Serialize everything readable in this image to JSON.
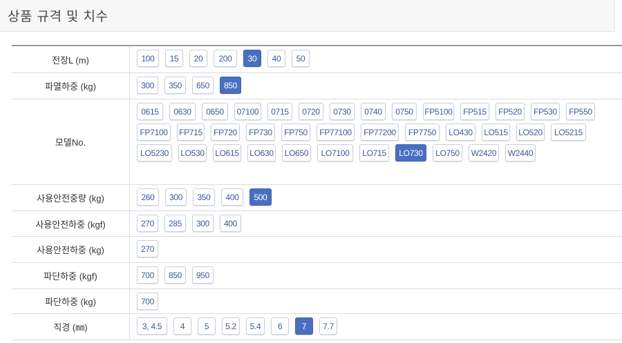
{
  "header": {
    "title": "상품 규격 및 치수"
  },
  "colors": {
    "selected_bg": "#4a6fc1",
    "option_text": "#3c5a9a",
    "border": "#c8cedc"
  },
  "rows": [
    {
      "label": "전장L (m)",
      "options": [
        "100",
        "15",
        "20",
        "200",
        "30",
        "40",
        "50"
      ],
      "selected": "30"
    },
    {
      "label": "파열하중 (kg)",
      "options": [
        "300",
        "350",
        "650",
        "850"
      ],
      "selected": "850"
    },
    {
      "label": "모델No.",
      "options": [
        "0615",
        "0630",
        "0650",
        "07100",
        "0715",
        "0720",
        "0730",
        "0740",
        "0750",
        "FP5100",
        "FP515",
        "FP520",
        "FP530",
        "FP550",
        "FP7100",
        "FP715",
        "FP720",
        "FP730",
        "FP750",
        "FP77100",
        "FP77200",
        "FP7750",
        "LO430",
        "LO515",
        "LO520",
        "LO5215",
        "LO5230",
        "LO530",
        "LO615",
        "LO630",
        "LO650",
        "LO7100",
        "LO715",
        "LO730",
        "LO750",
        "W2420",
        "W2440"
      ],
      "selected": "LO730"
    },
    {
      "label": "사용안전중량 (kg)",
      "options": [
        "260",
        "300",
        "350",
        "400",
        "500"
      ],
      "selected": "500"
    },
    {
      "label": "사용안전하중 (kgf)",
      "options": [
        "270",
        "285",
        "300",
        "400"
      ],
      "selected": null
    },
    {
      "label": "사용안전하중 (kg)",
      "options": [
        "270"
      ],
      "selected": null
    },
    {
      "label": "파단하중 (kgf)",
      "options": [
        "700",
        "850",
        "950"
      ],
      "selected": null
    },
    {
      "label": "파단하중 (kg)",
      "options": [
        "700"
      ],
      "selected": null
    },
    {
      "label": "직경 (㎜)",
      "options": [
        "3, 4.5",
        "4",
        "5",
        "5.2",
        "5.4",
        "6",
        "7",
        "7.7"
      ],
      "selected": "7"
    }
  ]
}
